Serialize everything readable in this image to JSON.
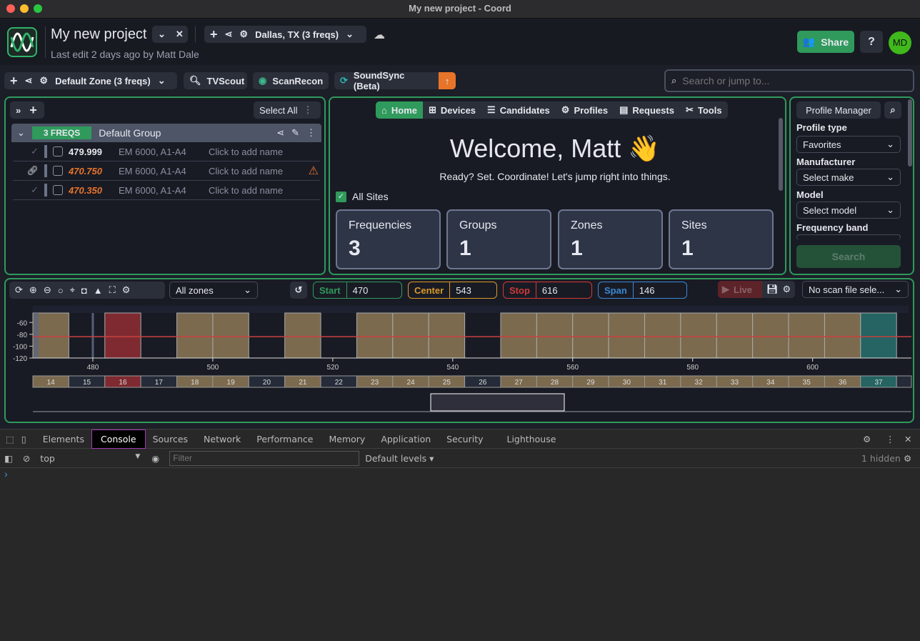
{
  "window": {
    "title": "My new project - Coord"
  },
  "header": {
    "project_name": "My new project",
    "last_edit": "Last edit 2 days ago by Matt Dale",
    "site_select": "Dallas, TX (3 freqs)",
    "share_label": "Share",
    "avatar_initials": "MD"
  },
  "toolbar": {
    "zone_select": "Default Zone (3 freqs)",
    "apps": [
      {
        "label": "TVScout"
      },
      {
        "label": "ScanRecon"
      },
      {
        "label": "SoundSync (Beta)"
      }
    ],
    "search_placeholder": "Search or jump to..."
  },
  "freq_panel": {
    "select_all": "Select All",
    "group": {
      "badge": "3 FREQS",
      "name": "Default Group"
    },
    "rows": [
      {
        "freq": "479.999",
        "device": "EM 6000, A1-A4",
        "name": "Click to add name",
        "status": "ok",
        "warning": false
      },
      {
        "freq": "470.750",
        "device": "EM 6000, A1-A4",
        "name": "Click to add name",
        "status": "linked",
        "warning": true
      },
      {
        "freq": "470.350",
        "device": "EM 6000, A1-A4",
        "name": "Click to add name",
        "status": "ok",
        "warning": false
      }
    ]
  },
  "home": {
    "tabs": [
      {
        "label": "Home"
      },
      {
        "label": "Devices"
      },
      {
        "label": "Candidates"
      },
      {
        "label": "Profiles"
      },
      {
        "label": "Requests"
      },
      {
        "label": "Tools"
      }
    ],
    "welcome": "Welcome, Matt 👋",
    "subtitle": "Ready? Set. Coordinate! Let's jump right into things.",
    "all_sites": "All Sites",
    "cards": [
      {
        "label": "Frequencies",
        "value": "3"
      },
      {
        "label": "Groups",
        "value": "1"
      },
      {
        "label": "Zones",
        "value": "1"
      },
      {
        "label": "Sites",
        "value": "1"
      }
    ]
  },
  "profile": {
    "title": "Profile Manager",
    "type_label": "Profile type",
    "type_value": "Favorites",
    "make_label": "Manufacturer",
    "make_value": "Select make",
    "model_label": "Model",
    "model_value": "Select model",
    "band_label": "Frequency band",
    "search": "Search"
  },
  "spectrum": {
    "zone_select": "All zones",
    "start_label": "Start",
    "start": "470",
    "center_label": "Center",
    "center": "543",
    "stop_label": "Stop",
    "stop": "616",
    "span_label": "Span",
    "span": "146",
    "live": "Live",
    "scan_file": "No scan file sele..."
  },
  "chart_data": {
    "type": "bar",
    "xlim": [
      470,
      616
    ],
    "ylim": [
      -120,
      -44
    ],
    "xticks": [
      480,
      500,
      520,
      540,
      560,
      580,
      600
    ],
    "yticks": [
      -60,
      -80,
      -100,
      -120
    ],
    "threshold": -84,
    "channels": [
      {
        "ch": "14",
        "start": 470,
        "status": "occupied"
      },
      {
        "ch": "15",
        "start": 476,
        "status": "open"
      },
      {
        "ch": "16",
        "start": 482,
        "status": "conflict"
      },
      {
        "ch": "17",
        "start": 488,
        "status": "open"
      },
      {
        "ch": "18",
        "start": 494,
        "status": "occupied"
      },
      {
        "ch": "19",
        "start": 500,
        "status": "occupied"
      },
      {
        "ch": "20",
        "start": 506,
        "status": "open"
      },
      {
        "ch": "21",
        "start": 512,
        "status": "occupied"
      },
      {
        "ch": "22",
        "start": 518,
        "status": "open"
      },
      {
        "ch": "23",
        "start": 524,
        "status": "occupied"
      },
      {
        "ch": "24",
        "start": 530,
        "status": "occupied"
      },
      {
        "ch": "25",
        "start": 536,
        "status": "occupied"
      },
      {
        "ch": "26",
        "start": 542,
        "status": "open"
      },
      {
        "ch": "27",
        "start": 548,
        "status": "occupied"
      },
      {
        "ch": "28",
        "start": 554,
        "status": "occupied"
      },
      {
        "ch": "29",
        "start": 560,
        "status": "occupied"
      },
      {
        "ch": "30",
        "start": 566,
        "status": "occupied"
      },
      {
        "ch": "31",
        "start": 572,
        "status": "occupied"
      },
      {
        "ch": "32",
        "start": 578,
        "status": "occupied"
      },
      {
        "ch": "33",
        "start": 584,
        "status": "occupied"
      },
      {
        "ch": "34",
        "start": 590,
        "status": "occupied"
      },
      {
        "ch": "35",
        "start": 596,
        "status": "occupied"
      },
      {
        "ch": "36",
        "start": 602,
        "status": "occupied"
      },
      {
        "ch": "37",
        "start": 608,
        "status": "reserved"
      }
    ],
    "markers": [
      470.35,
      470.75,
      479.999
    ],
    "colors": {
      "occupied": "#7b6a4e",
      "conflict": "#7f2a31",
      "reserved": "#256462",
      "open": "#252b38",
      "threshold": "#c8403f",
      "marker": "#5d6780"
    }
  },
  "devtools": {
    "tabs": [
      {
        "label": "Elements"
      },
      {
        "label": "Console"
      },
      {
        "label": "Sources"
      },
      {
        "label": "Network"
      },
      {
        "label": "Performance"
      },
      {
        "label": "Memory"
      },
      {
        "label": "Application"
      },
      {
        "label": "Security"
      },
      {
        "label": "Lighthouse"
      }
    ],
    "context": "top",
    "filter_placeholder": "Filter",
    "levels": "Default levels ▾",
    "hidden": "1 hidden",
    "prompt": "›"
  },
  "colors": {
    "accent": "#2f9a5c",
    "warning": "#e8742a"
  }
}
